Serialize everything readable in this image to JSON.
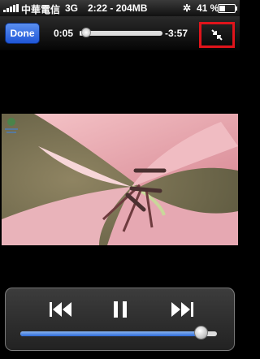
{
  "status_bar": {
    "carrier": "中華電信",
    "network": "3G",
    "time_and_data": "2:22 - 204MB",
    "battery_percent_text": "41 %",
    "battery_level": 0.41
  },
  "player": {
    "done_label": "Done",
    "elapsed": "0:05",
    "remaining": "-3:57",
    "scrubber_progress": 0.02,
    "volume_level": 0.95
  },
  "icons": {
    "signal": "signal-bars-icon",
    "activity": "activity-spinner-icon",
    "battery": "battery-icon",
    "fullscreen": "fullscreen-toggle-icon",
    "previous": "skip-previous-icon",
    "pause": "pause-icon",
    "next": "skip-next-icon"
  },
  "colors": {
    "done_button": "#2f67e0",
    "highlight_box": "#e0141b",
    "volume_fill": "#2e6bd8"
  }
}
